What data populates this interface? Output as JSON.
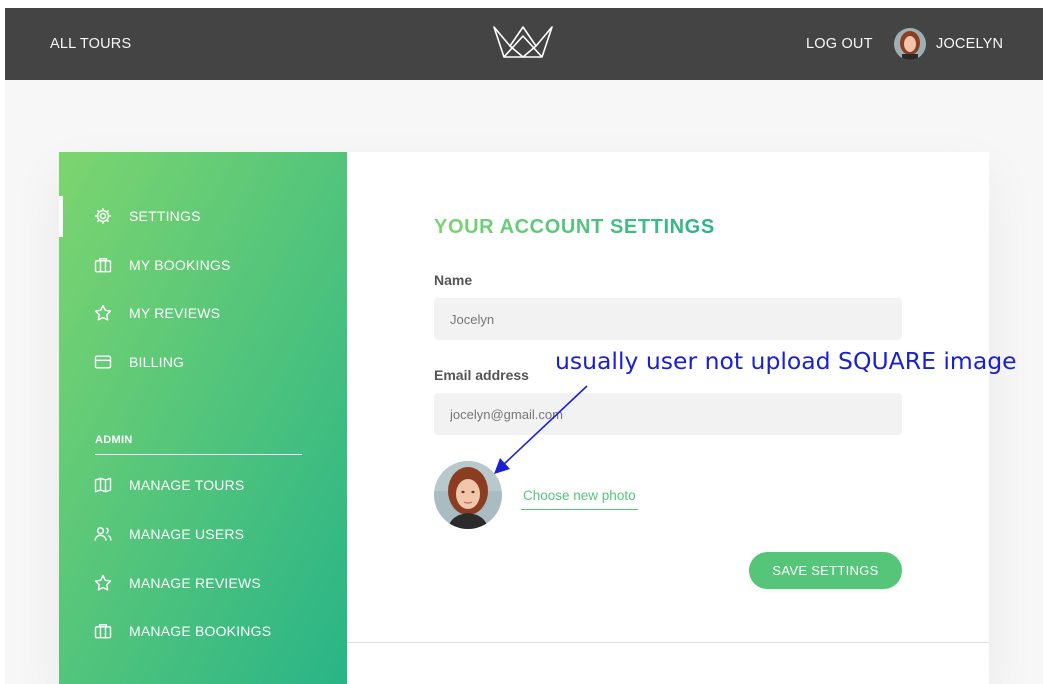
{
  "header": {
    "all_tours": "ALL TOURS",
    "logout": "LOG OUT",
    "user_name": "JOCELYN"
  },
  "sidebar": {
    "items": [
      {
        "label": "SETTINGS",
        "icon": "settings-icon",
        "active": true
      },
      {
        "label": "MY BOOKINGS",
        "icon": "briefcase-icon"
      },
      {
        "label": "MY REVIEWS",
        "icon": "star-icon"
      },
      {
        "label": "BILLING",
        "icon": "credit-card-icon"
      }
    ],
    "admin_title": "ADMIN",
    "admin_items": [
      {
        "label": "MANAGE TOURS",
        "icon": "map-icon"
      },
      {
        "label": "MANAGE USERS",
        "icon": "users-icon"
      },
      {
        "label": "MANAGE REVIEWS",
        "icon": "star-icon"
      },
      {
        "label": "MANAGE BOOKINGS",
        "icon": "briefcase-icon"
      }
    ]
  },
  "form": {
    "title": "YOUR ACCOUNT SETTINGS",
    "name_label": "Name",
    "name_value": "Jocelyn",
    "email_label": "Email address",
    "email_value": "jocelyn@gmail.com",
    "choose_photo": "Choose new photo",
    "save_button": "SAVE SETTINGS"
  },
  "annotation": {
    "text": "usually user not upload SQUARE image",
    "color": "#1a20d4"
  },
  "colors": {
    "header_bg": "#444444",
    "accent": "#55c57a",
    "gradient_start": "#7dd56f",
    "gradient_end": "#28b487"
  }
}
